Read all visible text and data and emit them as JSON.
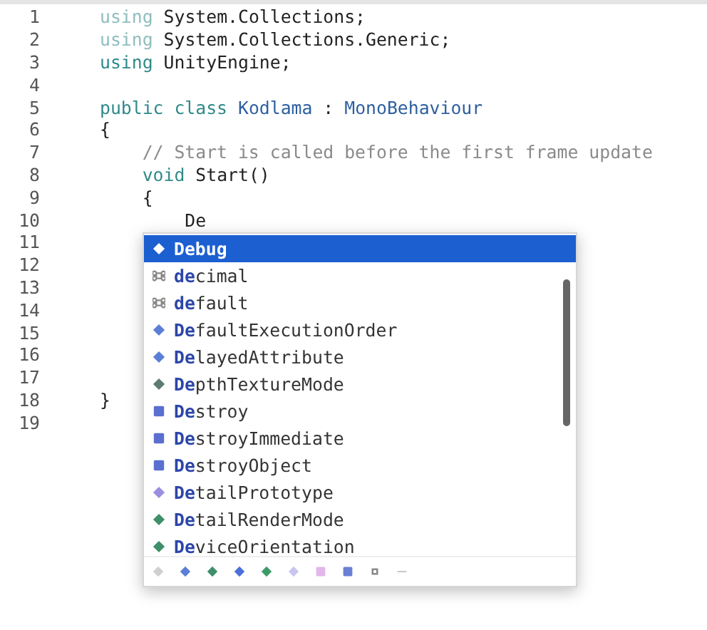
{
  "editor": {
    "lines": [
      {
        "number": "1",
        "tokens": [
          {
            "kind": "faded",
            "text": "using"
          },
          {
            "kind": "plain",
            "text": " System.Collections;"
          }
        ]
      },
      {
        "number": "2",
        "tokens": [
          {
            "kind": "faded",
            "text": "using"
          },
          {
            "kind": "plain",
            "text": " System.Collections.Generic;"
          }
        ]
      },
      {
        "number": "3",
        "tokens": [
          {
            "kind": "keyword",
            "text": "using"
          },
          {
            "kind": "plain",
            "text": " UnityEngine;"
          }
        ]
      },
      {
        "number": "4"
      },
      {
        "number": "5",
        "tokens": [
          {
            "kind": "keyword",
            "text": "public class"
          },
          {
            "kind": "type",
            "text": " Kodlama"
          },
          {
            "kind": "plain",
            "text": " : "
          },
          {
            "kind": "type",
            "text": "MonoBehaviour"
          }
        ]
      },
      {
        "number": "6",
        "tokens": [
          {
            "kind": "plain",
            "text": "{"
          }
        ]
      },
      {
        "number": "7",
        "tokens": [
          {
            "kind": "comment",
            "text": "    // Start is called before the first frame update"
          }
        ]
      },
      {
        "number": "8",
        "tokens": [
          {
            "kind": "keyword",
            "text": "    void"
          },
          {
            "kind": "plain",
            "text": " Start()"
          }
        ]
      },
      {
        "number": "9",
        "tokens": [
          {
            "kind": "plain",
            "text": "    {"
          }
        ]
      },
      {
        "number": "10",
        "tokens": [
          {
            "kind": "plain",
            "text": "        De"
          }
        ]
      },
      {
        "number": "11"
      },
      {
        "number": "12"
      },
      {
        "number": "13"
      },
      {
        "number": "14"
      },
      {
        "number": "15"
      },
      {
        "number": "16"
      },
      {
        "number": "17"
      },
      {
        "number": "18",
        "tokens": [
          {
            "kind": "plain",
            "text": "}"
          }
        ]
      },
      {
        "number": "19"
      }
    ]
  },
  "completion": {
    "items": [
      {
        "kind": "class",
        "match": "De",
        "rest": "bug",
        "selected": true
      },
      {
        "kind": "keyword",
        "match": "de",
        "rest": "cimal",
        "selected": false
      },
      {
        "kind": "keyword",
        "match": "de",
        "rest": "fault",
        "selected": false
      },
      {
        "kind": "class",
        "match": "De",
        "rest": "faultExecutionOrder",
        "selected": false
      },
      {
        "kind": "class",
        "match": "De",
        "rest": "layedAttribute",
        "selected": false
      },
      {
        "kind": "struct",
        "match": "De",
        "rest": "pthTextureMode",
        "selected": false
      },
      {
        "kind": "method",
        "match": "De",
        "rest": "stroy",
        "selected": false
      },
      {
        "kind": "method",
        "match": "De",
        "rest": "stroyImmediate",
        "selected": false
      },
      {
        "kind": "method",
        "match": "De",
        "rest": "stroyObject",
        "selected": false
      },
      {
        "kind": "delegate",
        "match": "De",
        "rest": "tailPrototype",
        "selected": false
      },
      {
        "kind": "enum",
        "match": "De",
        "rest": "tailRenderMode",
        "selected": false
      },
      {
        "kind": "enum",
        "match": "De",
        "rest": "viceOrientation",
        "selected": false
      }
    ]
  }
}
